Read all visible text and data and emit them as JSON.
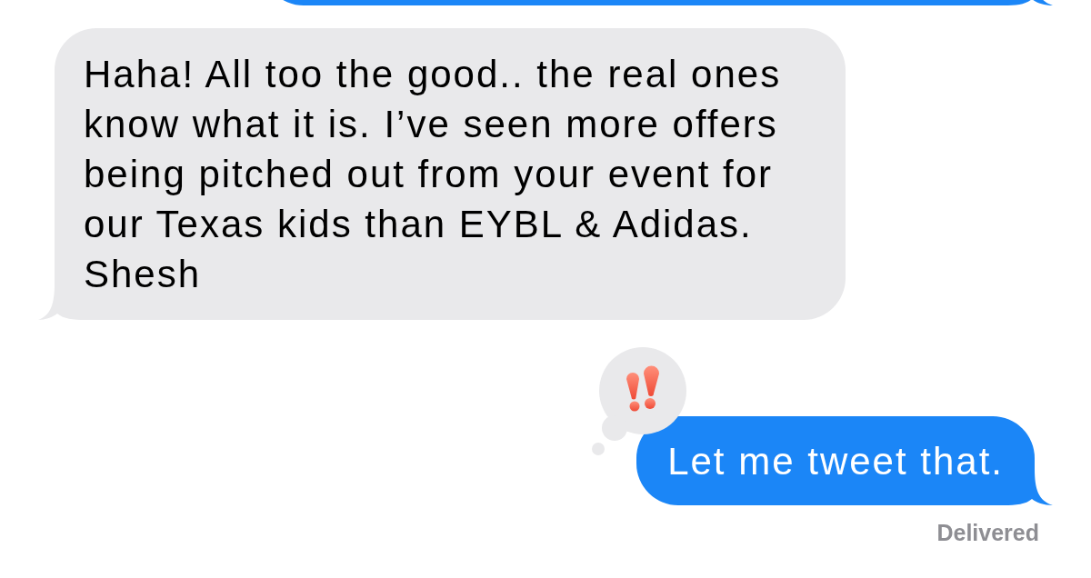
{
  "messages": [
    {
      "kind": "sent"
    },
    {
      "kind": "received",
      "text": "Haha! All too the good.. the real ones know what it is. I’ve seen more offers being pitched out from your event for our Texas kids than EYBL & Adidas. Shesh",
      "emphasized": false
    },
    {
      "kind": "sent",
      "text": "Let me tweet that.",
      "emphasized": true,
      "status": "Delivered"
    }
  ]
}
